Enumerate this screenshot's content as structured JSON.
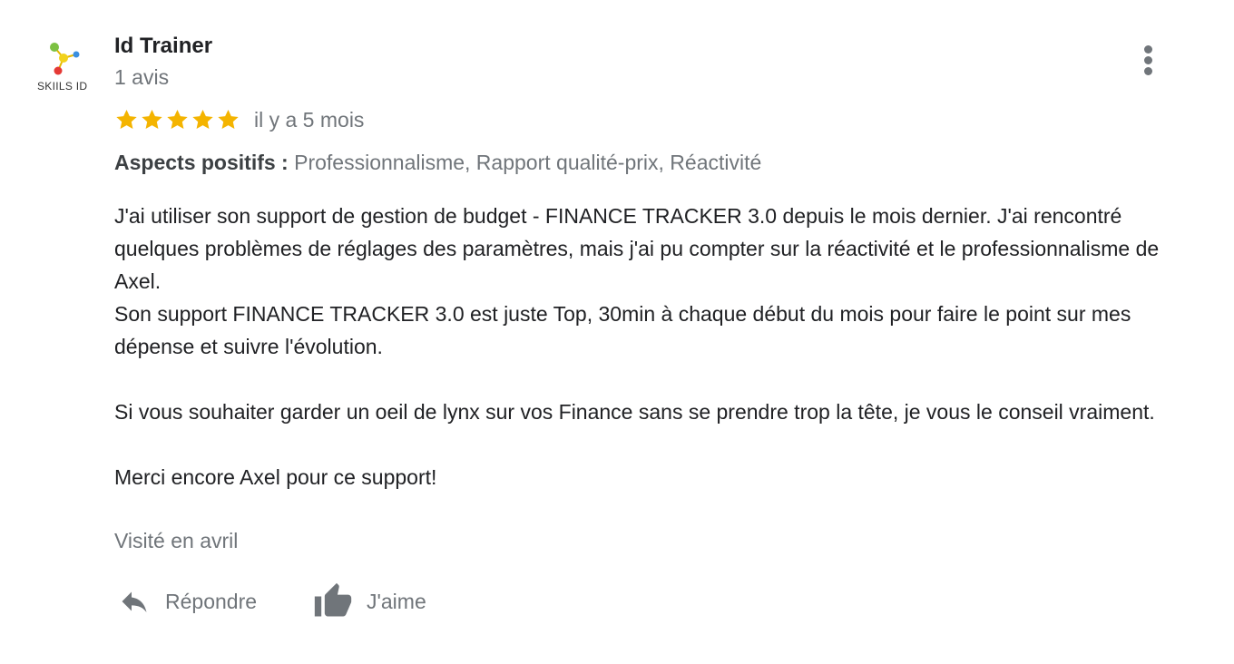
{
  "review": {
    "author": {
      "name": "Id Trainer",
      "review_count": "1 avis",
      "avatar_text": "SKIILS ID",
      "avatar_icon": "molecule-logo-icon"
    },
    "rating": {
      "stars": 5,
      "max_stars": 5,
      "star_color": "#f4b400",
      "time_ago": "il y a 5 mois"
    },
    "aspects": {
      "label": "Aspects positifs :",
      "values": "Professionnalisme, Rapport qualité-prix, Réactivité"
    },
    "text": {
      "p1": "J'ai utiliser son support de gestion de budget - FINANCE TRACKER 3.0 depuis le mois dernier. J'ai rencontré quelques problèmes de réglages des paramètres, mais j'ai pu compter sur la réactivité et le professionnalisme de Axel.",
      "p2": "Son support FINANCE TRACKER 3.0 est juste Top, 30min à chaque début du mois pour faire le point sur mes dépense et suivre l'évolution.",
      "p3": "Si vous souhaiter garder un oeil de lynx sur vos Finance sans se prendre trop la tête, je vous le conseil vraiment.",
      "p4": "Merci encore Axel pour ce support!"
    },
    "visited": "Visité en avril",
    "actions": {
      "reply_label": "Répondre",
      "reply_icon": "reply-icon",
      "like_label": "J'aime",
      "like_icon": "thumbs-up-icon"
    },
    "menu_icon": "more-vert-icon"
  }
}
